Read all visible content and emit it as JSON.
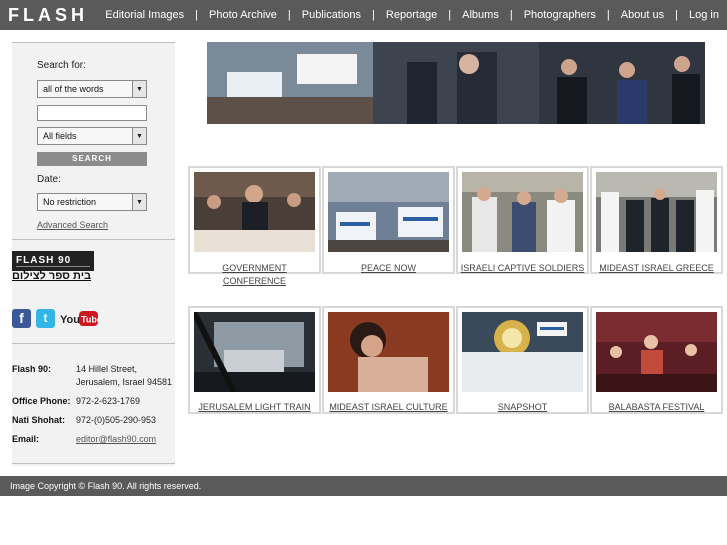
{
  "header": {
    "logo_text": "FLASH",
    "nav": [
      "Editorial Images",
      "Photo Archive",
      "Publications",
      "Reportage",
      "Albums",
      "Photographers",
      "About us",
      "Log in"
    ]
  },
  "search": {
    "label": "Search for:",
    "match_value": "all of the words",
    "query_value": "",
    "field_value": "All fields",
    "button_label": "search",
    "date_label": "Date:",
    "date_value": "No restriction",
    "advanced_link": "Advanced Search"
  },
  "school": {
    "logo_text": "FLASH 90",
    "hebrew_text": "בית ספר לצילום"
  },
  "social": {
    "facebook": "facebook-icon",
    "twitter": "twitter-icon",
    "youtube_label": "You Tube"
  },
  "contact": {
    "flash90_label": "Flash 90:",
    "address_line1": "14 Hillel Street,",
    "address_line2": "Jerusalem, Israel 94581",
    "office_label": "Office Phone:",
    "office_phone": "972-2-623-1769",
    "nati_label": "Nati Shohat:",
    "nati_phone": "972-(0)505-290-953",
    "email_label": "Email:",
    "email": "editor@flash90.com"
  },
  "gallery": [
    {
      "title_line1": "GOVERNMENT",
      "title_line2": "CONFERENCE"
    },
    {
      "title_line1": "PEACE NOW",
      "title_line2": ""
    },
    {
      "title_line1": "ISRAELI CAPTIVE SOLDIERS",
      "title_line2": ""
    },
    {
      "title_line1": "MIDEAST ISRAEL GREECE",
      "title_line2": ""
    },
    {
      "title_line1": "JERUSALEM LIGHT TRAIN",
      "title_line2": ""
    },
    {
      "title_line1": "MIDEAST ISRAEL CULTURE",
      "title_line2": ""
    },
    {
      "title_line1": "SNAPSHOT",
      "title_line2": ""
    },
    {
      "title_line1": "BALABASTA FESTIVAL",
      "title_line2": ""
    }
  ],
  "footer": {
    "copyright": "Image Copyright © Flash 90. All rights reserved."
  },
  "colors": {
    "bar": "#5a5a5a",
    "sidebar": "#f2f2f2",
    "card_border": "#d8d8d8"
  }
}
